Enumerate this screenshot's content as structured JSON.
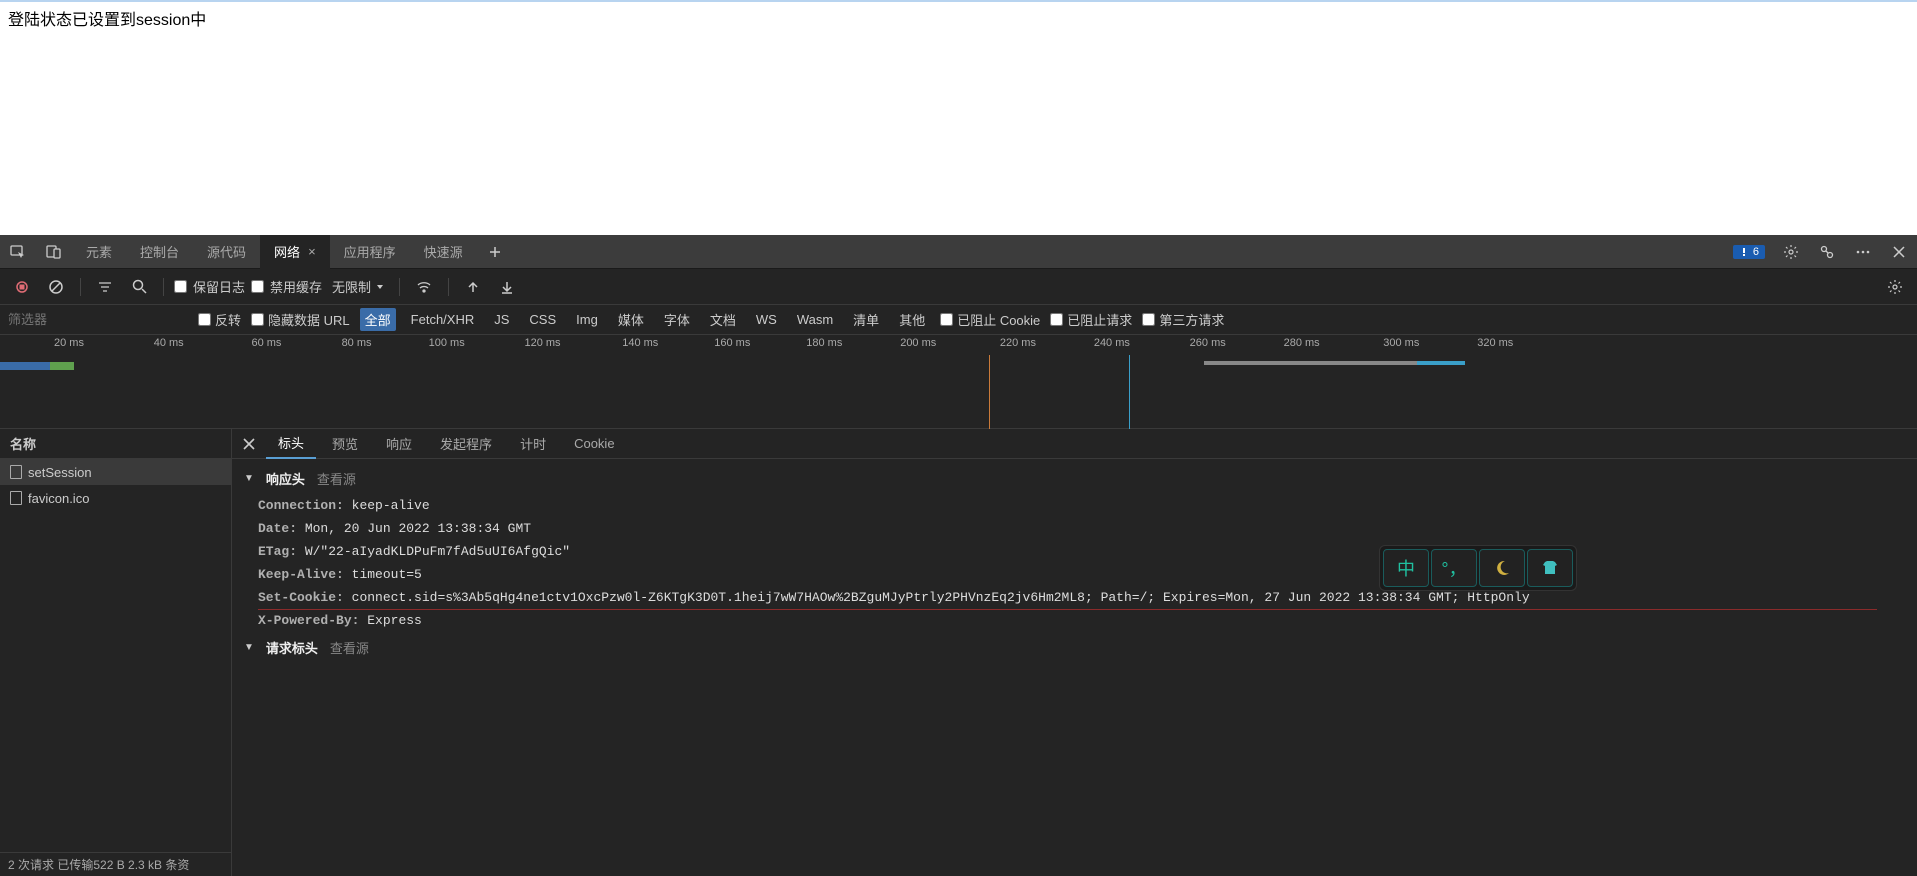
{
  "page": {
    "message": "登陆状态已设置到session中"
  },
  "devtools": {
    "tabs": [
      "元素",
      "控制台",
      "源代码",
      "网络",
      "应用程序",
      "快速源"
    ],
    "activeTab": "网络",
    "badgeCount": "6",
    "toolbar": {
      "preserveLog": "保留日志",
      "disableCache": "禁用缓存",
      "throttle": "无限制"
    },
    "filter": {
      "placeholder": "筛选器",
      "invert": "反转",
      "hideDataUrls": "隐藏数据 URL",
      "types": [
        "全部",
        "Fetch/XHR",
        "JS",
        "CSS",
        "Img",
        "媒体",
        "字体",
        "文档",
        "WS",
        "Wasm",
        "清单",
        "其他"
      ],
      "activeType": "全部",
      "blockedCookies": "已阻止 Cookie",
      "blockedReq": "已阻止请求",
      "thirdParty": "第三方请求"
    },
    "timeline": {
      "ticks": [
        "20 ms",
        "40 ms",
        "60 ms",
        "80 ms",
        "100 ms",
        "120 ms",
        "140 ms",
        "160 ms",
        "180 ms",
        "200 ms",
        "220 ms",
        "240 ms",
        "260 ms",
        "280 ms",
        "300 ms",
        "320 ms"
      ]
    },
    "requests": {
      "header": "名称",
      "items": [
        {
          "name": "setSession",
          "selected": true
        },
        {
          "name": "favicon.ico",
          "selected": false
        }
      ],
      "summary": "2 次请求   已传输522 B   2.3 kB 条资"
    },
    "detail": {
      "tabs": [
        "标头",
        "预览",
        "响应",
        "发起程序",
        "计时",
        "Cookie"
      ],
      "activeTab": "标头",
      "responseSection": {
        "title": "响应头",
        "viewSource": "查看源"
      },
      "responseHeaders": [
        {
          "k": "Connection:",
          "v": "keep-alive"
        },
        {
          "k": "Date:",
          "v": "Mon, 20 Jun 2022 13:38:34 GMT"
        },
        {
          "k": "ETag:",
          "v": "W/\"22-aIyadKLDPuFm7fAd5uUI6AfgQic\""
        },
        {
          "k": "Keep-Alive:",
          "v": "timeout=5"
        },
        {
          "k": "Set-Cookie:",
          "v": "connect.sid=s%3Ab5qHg4ne1ctv1OxcPzw0l-Z6KTgK3D0T.1heij7wW7HAOw%2BZguMJyPtrly2PHVnzEq2jv6Hm2ML8; Path=/; Expires=Mon, 27 Jun 2022 13:38:34 GMT; HttpOnly"
        },
        {
          "k": "X-Powered-By:",
          "v": "Express"
        }
      ],
      "requestSection": {
        "title": "请求标头",
        "viewSource": "查看源"
      }
    }
  },
  "ime": {
    "zh": "中",
    "punct": "°，"
  }
}
